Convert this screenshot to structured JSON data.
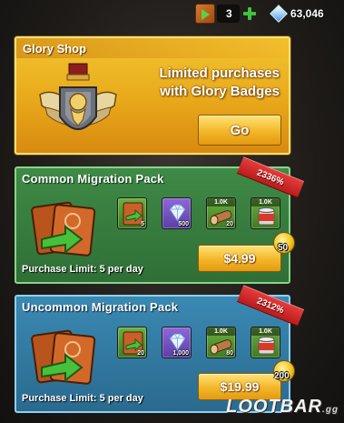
{
  "resources": {
    "glory_badges": "3",
    "diamonds": "63,046"
  },
  "glory_shop": {
    "title": "Glory Shop",
    "desc_line1": "Limited purchases",
    "desc_line2": "with Glory Badges",
    "button": "Go"
  },
  "packs": [
    {
      "title": "Common Migration Pack",
      "discount": "2336%",
      "limit": "Purchase Limit: 5 per day",
      "price": "$4.99",
      "coin_value": "50",
      "items": [
        {
          "icon": "migration-badge-icon",
          "top": "",
          "qty": "5"
        },
        {
          "icon": "diamond-icon",
          "top": "",
          "qty": "500"
        },
        {
          "icon": "wood-icon",
          "top": "1.0K",
          "qty": "20"
        },
        {
          "icon": "food-can-icon",
          "top": "1.0K",
          "qty": ""
        }
      ]
    },
    {
      "title": "Uncommon Migration Pack",
      "discount": "2312%",
      "limit": "Purchase Limit: 5 per day",
      "price": "$19.99",
      "coin_value": "200",
      "items": [
        {
          "icon": "migration-badge-icon",
          "top": "",
          "qty": "20"
        },
        {
          "icon": "diamond-icon",
          "top": "",
          "qty": "1,000"
        },
        {
          "icon": "wood-icon",
          "top": "1.0K",
          "qty": "80"
        },
        {
          "icon": "food-can-icon",
          "top": "1.0K",
          "qty": ""
        }
      ]
    }
  ],
  "watermark": {
    "main": "LOOTBAR",
    "suffix": ".gg"
  },
  "colors": {
    "glory_gold": "#f3c531",
    "common_green": "#3f8a46",
    "uncommon_blue": "#3a89b3",
    "discount_red": "#e53b3b",
    "price_button": "#f3b728"
  }
}
